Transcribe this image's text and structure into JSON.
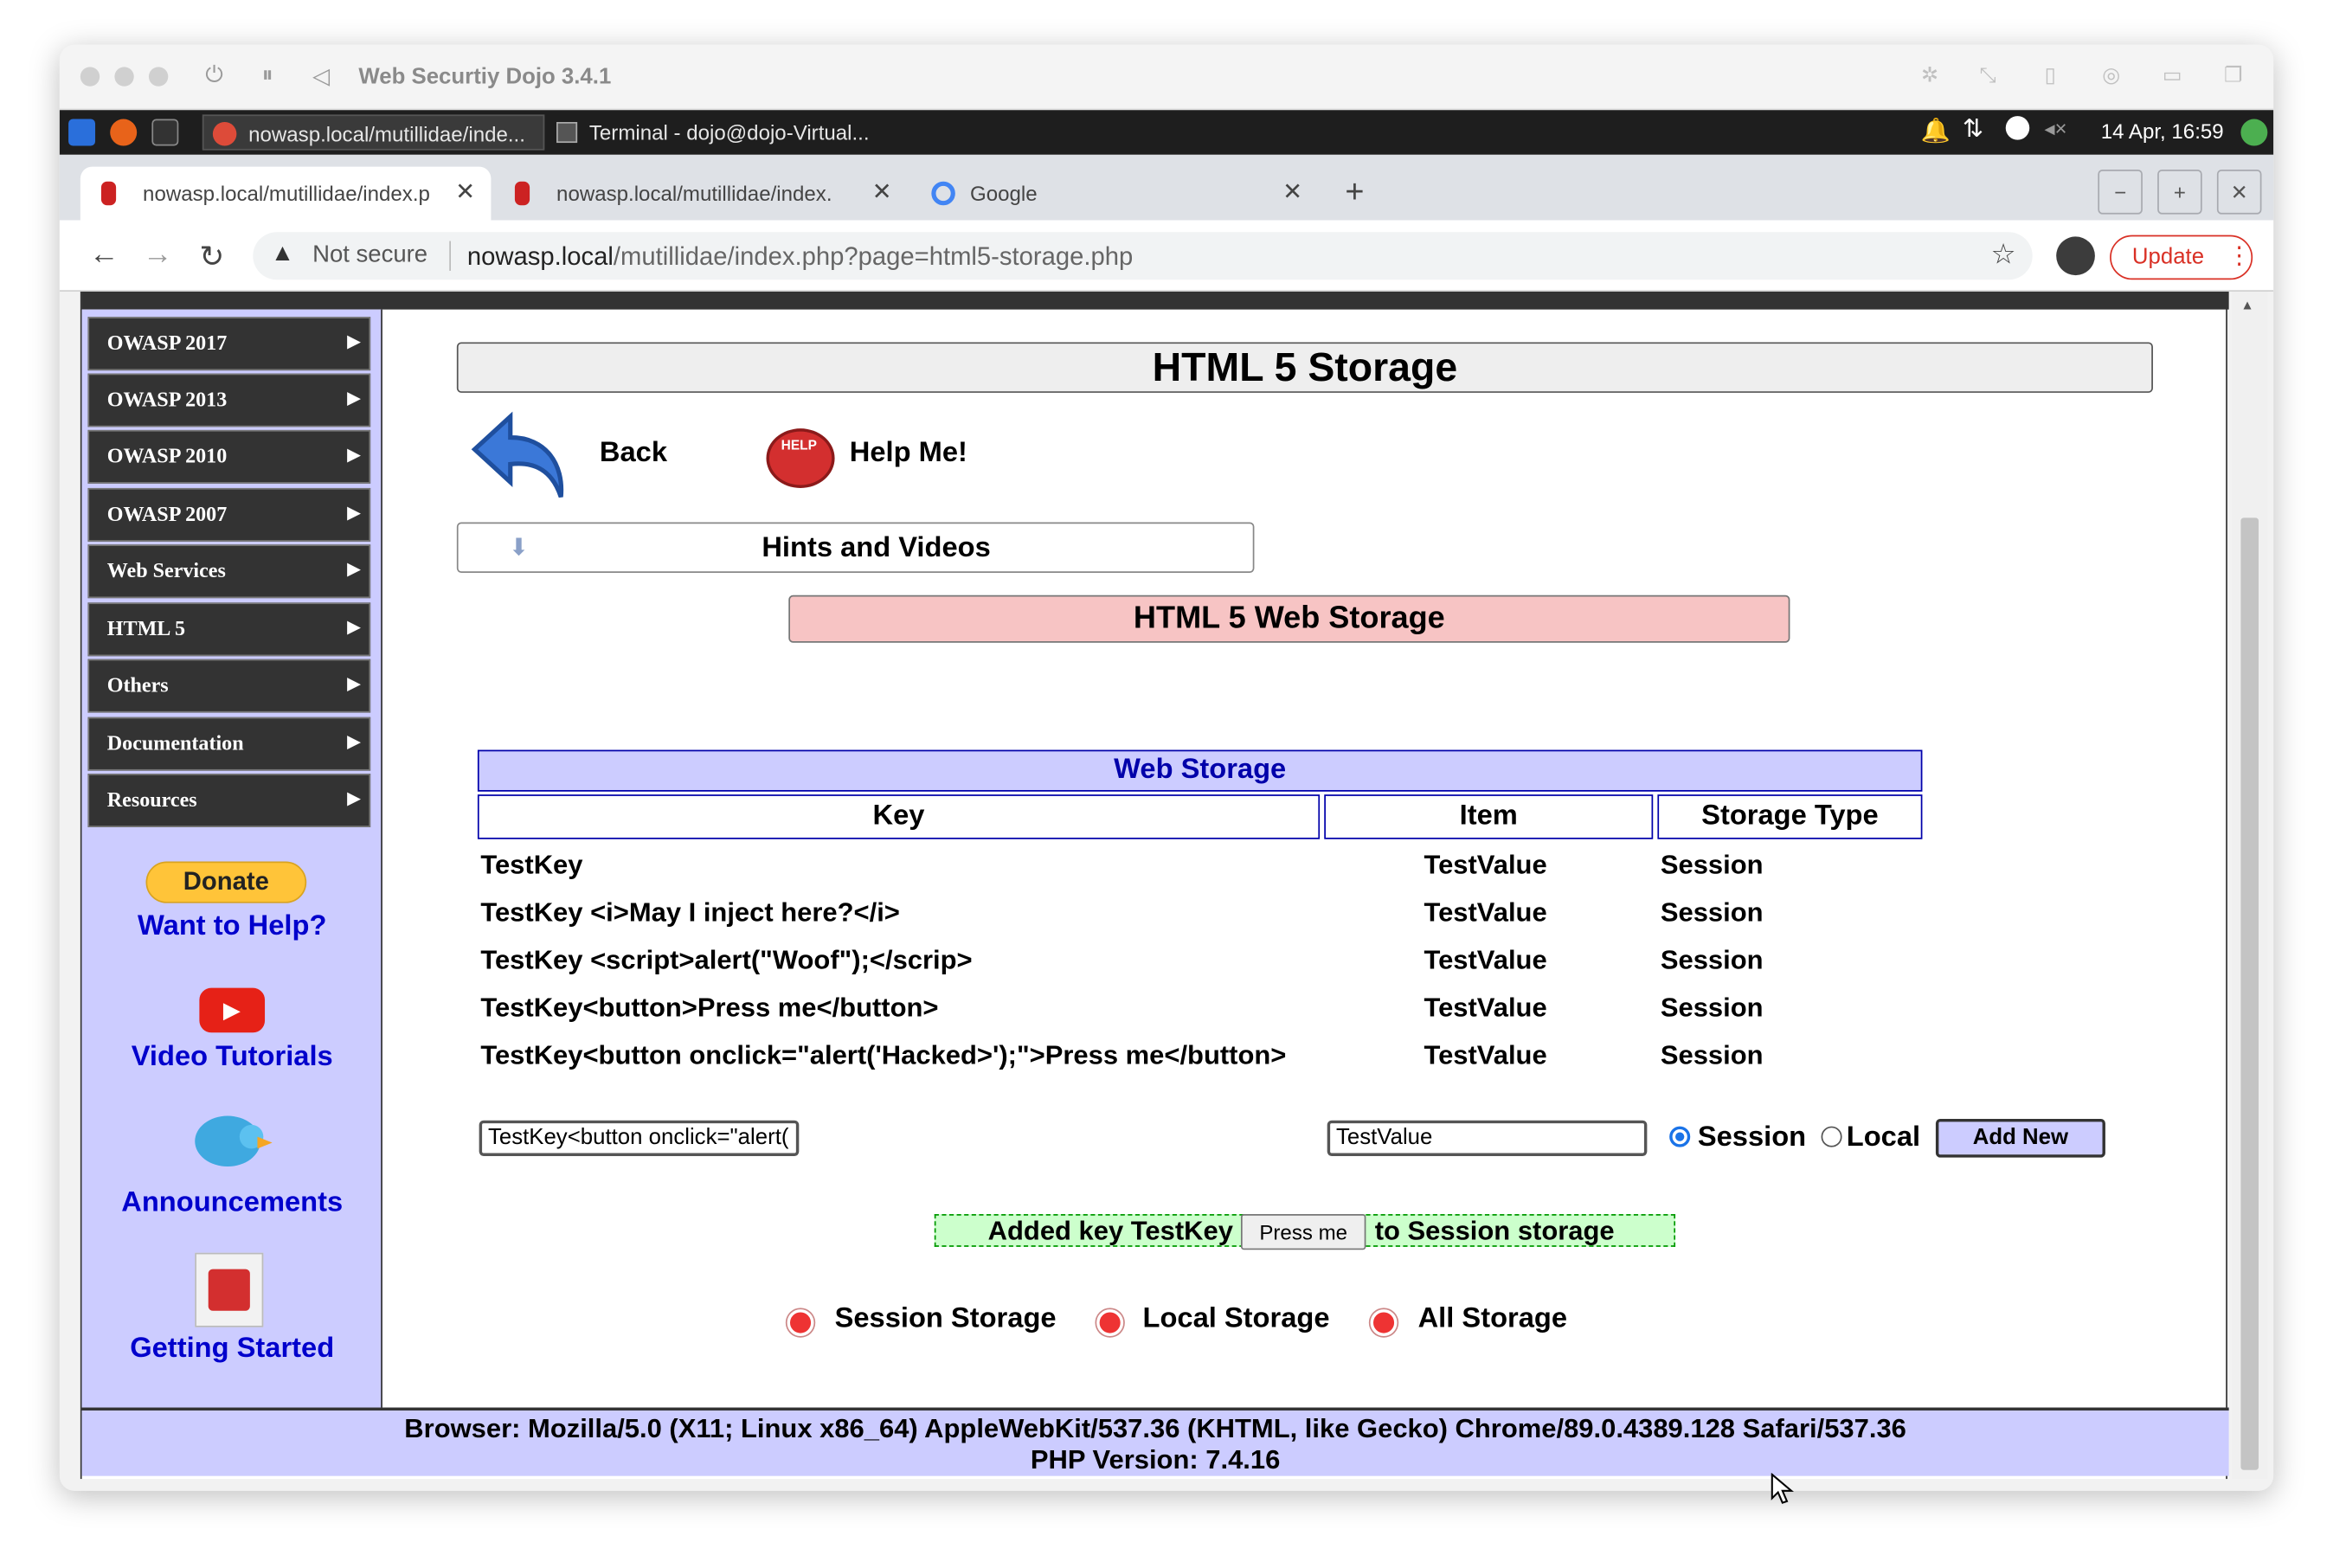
{
  "vm_window": {
    "title": "Web Securtiy Dojo 3.4.1"
  },
  "taskbar": {
    "tasks": [
      {
        "label": "nowasp.local/mutillidae/inde..."
      },
      {
        "label": "Terminal - dojo@dojo-Virtual..."
      }
    ],
    "clock": "14 Apr, 16:59"
  },
  "browser": {
    "tabs": [
      {
        "label": "nowasp.local/mutillidae/index.p"
      },
      {
        "label": "nowasp.local/mutillidae/index.p"
      },
      {
        "label": "Google"
      }
    ],
    "new_tab": "+",
    "close_glyph": "✕",
    "window_buttons": [
      "−",
      "+",
      "✕"
    ],
    "security_label": "Not secure",
    "url_host": "nowasp.local",
    "url_path": "/mutillidae/index.php?page=html5-storage.php",
    "update_label": "Update"
  },
  "sidebar": {
    "menu": [
      {
        "label": "OWASP 2017"
      },
      {
        "label": "OWASP 2013"
      },
      {
        "label": "OWASP 2010"
      },
      {
        "label": "OWASP 2007"
      },
      {
        "label": "Web Services"
      },
      {
        "label": "HTML 5"
      },
      {
        "label": "Others"
      },
      {
        "label": "Documentation"
      },
      {
        "label": "Resources"
      }
    ],
    "donate_label": "Donate",
    "help_link": "Want to Help?",
    "video_link": "Video Tutorials",
    "announcements_link": "Announcements",
    "getting_started_link": "Getting Started"
  },
  "main": {
    "title": "HTML 5 Storage",
    "back_label": "Back",
    "help_label": "Help Me!",
    "hints_label": "Hints and Videos",
    "section_title": "HTML 5 Web Storage",
    "table": {
      "caption": "Web Storage",
      "headers": [
        "Key",
        "Item",
        "Storage Type"
      ],
      "rows": [
        [
          "TestKey",
          "TestValue",
          "Session"
        ],
        [
          "TestKey <i>May I inject here?</i>",
          "TestValue",
          "Session"
        ],
        [
          "TestKey <script>alert(\"Woof\");</scrip>",
          "TestValue",
          "Session"
        ],
        [
          "TestKey<button>Press me</button>",
          "TestValue",
          "Session"
        ],
        [
          "TestKey<button onclick=\"alert('Hacked>');\">Press me</button>",
          "TestValue",
          "Session"
        ]
      ]
    },
    "form": {
      "key_value": "TestKey<button onclick=\"alert(",
      "item_value": "TestValue",
      "radio_session": "Session",
      "radio_local": "Local",
      "add_button": "Add New",
      "selected_storage": "Session"
    },
    "message": {
      "prefix": "Added key TestKey",
      "button": "Press me",
      "suffix": "to Session storage"
    },
    "clear_links": [
      "Session Storage",
      "Local Storage",
      "All Storage"
    ]
  },
  "footer": {
    "browser_line": "Browser: Mozilla/5.0 (X11; Linux x86_64) AppleWebKit/537.36 (KHTML, like Gecko) Chrome/89.0.4389.128 Safari/537.36",
    "php_line": "PHP Version: 7.4.16"
  },
  "colors": {
    "sidebar_bg": "#ccccff",
    "menu_bg": "#333333",
    "link_blue": "#0000cc",
    "section_pink": "#f7c4c4",
    "table_header_bg": "#ccccff",
    "message_bg": "#ccffcc"
  }
}
